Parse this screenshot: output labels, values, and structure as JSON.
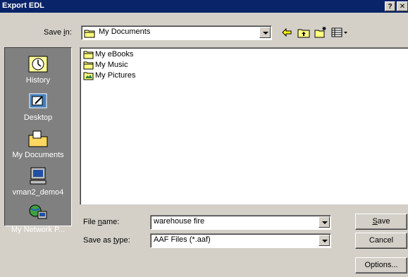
{
  "window": {
    "title": "Export EDL",
    "help_label": "?",
    "close_label": "✕"
  },
  "save_in": {
    "label_pre": "Save ",
    "label_hot": "i",
    "label_post": "n:",
    "value": "My Documents"
  },
  "toolbar": {
    "icons": [
      "back-icon",
      "up-one-level-icon",
      "create-new-folder-icon",
      "view-menu-icon"
    ]
  },
  "places": [
    {
      "label": "History",
      "icon": "history-icon"
    },
    {
      "label": "Desktop",
      "icon": "desktop-icon"
    },
    {
      "label": "My Documents",
      "icon": "my-documents-icon"
    },
    {
      "label": "vman2_demo4",
      "icon": "my-computer-icon"
    },
    {
      "label": "My Network P...",
      "icon": "network-places-icon"
    }
  ],
  "files": [
    {
      "name": "My eBooks",
      "icon": "folder-icon"
    },
    {
      "name": "My Music",
      "icon": "folder-icon"
    },
    {
      "name": "My Pictures",
      "icon": "pictures-folder-icon"
    }
  ],
  "file_name": {
    "label_pre": "File ",
    "label_hot": "n",
    "label_post": "ame:",
    "value": "warehouse fire"
  },
  "save_as_type": {
    "label_pre": "Save as ",
    "label_hot": "t",
    "label_post": "ype:",
    "value": "AAF Files (*.aaf)"
  },
  "buttons": {
    "save_hot": "S",
    "save_rest": "ave",
    "cancel": "Cancel",
    "options": "Options..."
  },
  "colors": {
    "titlebar": "#0a246a",
    "face": "#d4d0c8",
    "places_bg": "#808080"
  }
}
